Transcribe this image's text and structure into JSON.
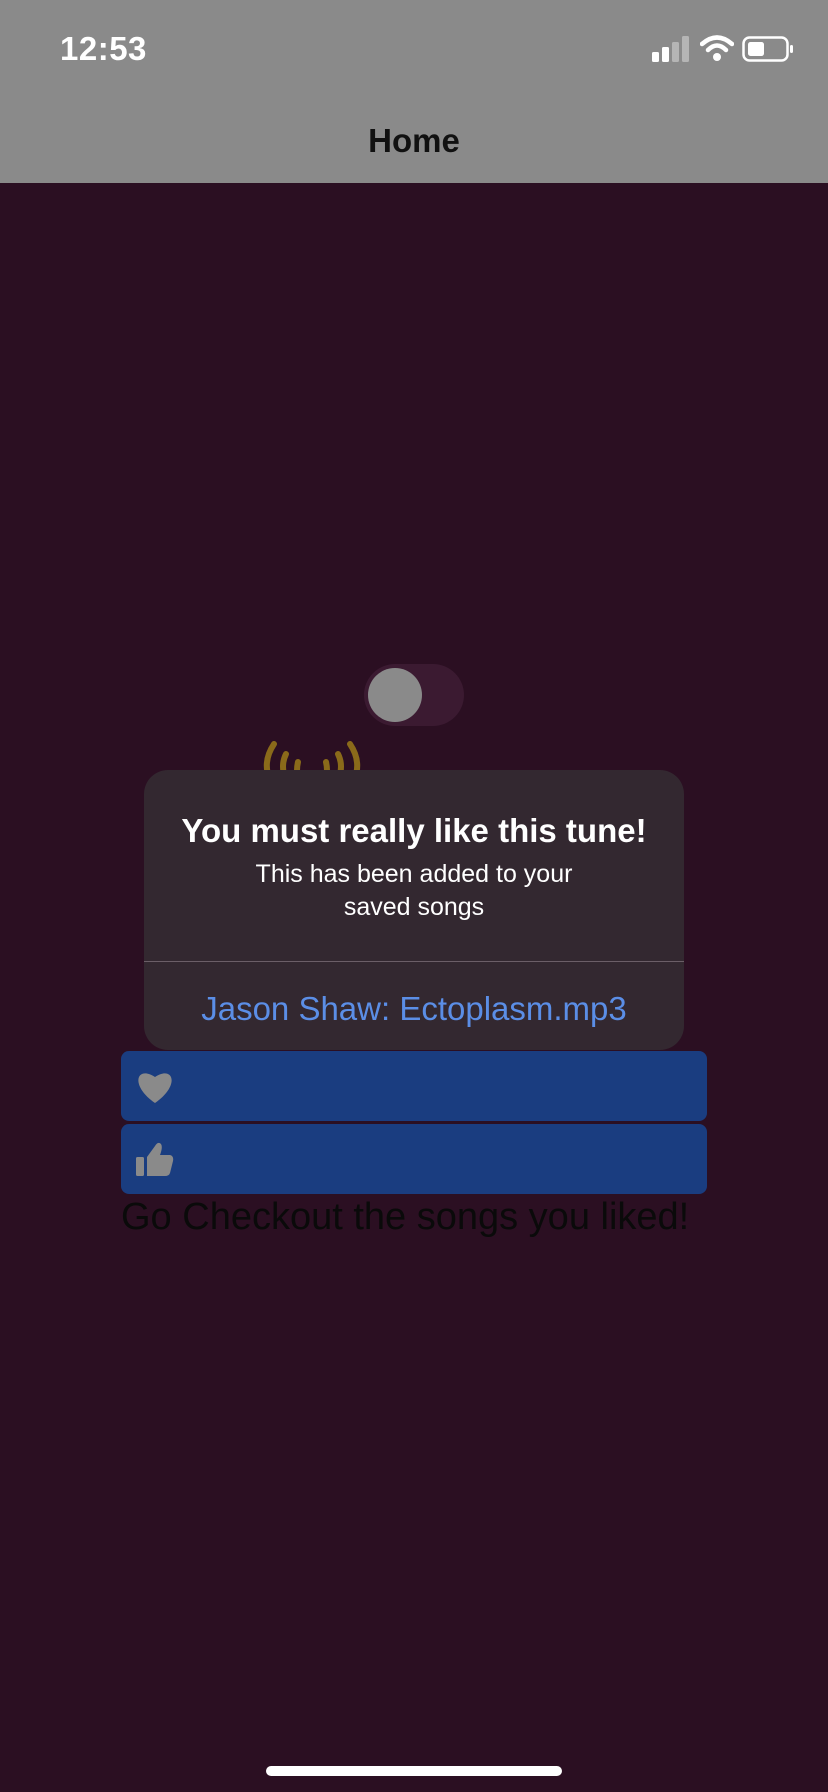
{
  "status_bar": {
    "time": "12:53",
    "icons": [
      "cellular-signal-icon",
      "wifi-icon",
      "battery-icon"
    ]
  },
  "nav": {
    "title": "Home"
  },
  "player": {
    "toggle_on": false,
    "sound_icon": "sound-waves-icon"
  },
  "alert": {
    "title": "You must really like this tune!",
    "message": "This has been added to your saved songs",
    "action": "Jason Shaw: Ectoplasm.mp3"
  },
  "rows": [
    {
      "icon": "heart-icon"
    },
    {
      "icon": "thumbs-up-icon"
    }
  ],
  "liked_prompt": "Go Checkout the songs you liked!",
  "colors": {
    "background": "#2b0f22",
    "header": "#8a8a8a",
    "alert_bg": "#332830",
    "action_blue": "#5b8ee6",
    "row_blue": "#1a3d80",
    "sound_icon": "#8a6a1a"
  }
}
